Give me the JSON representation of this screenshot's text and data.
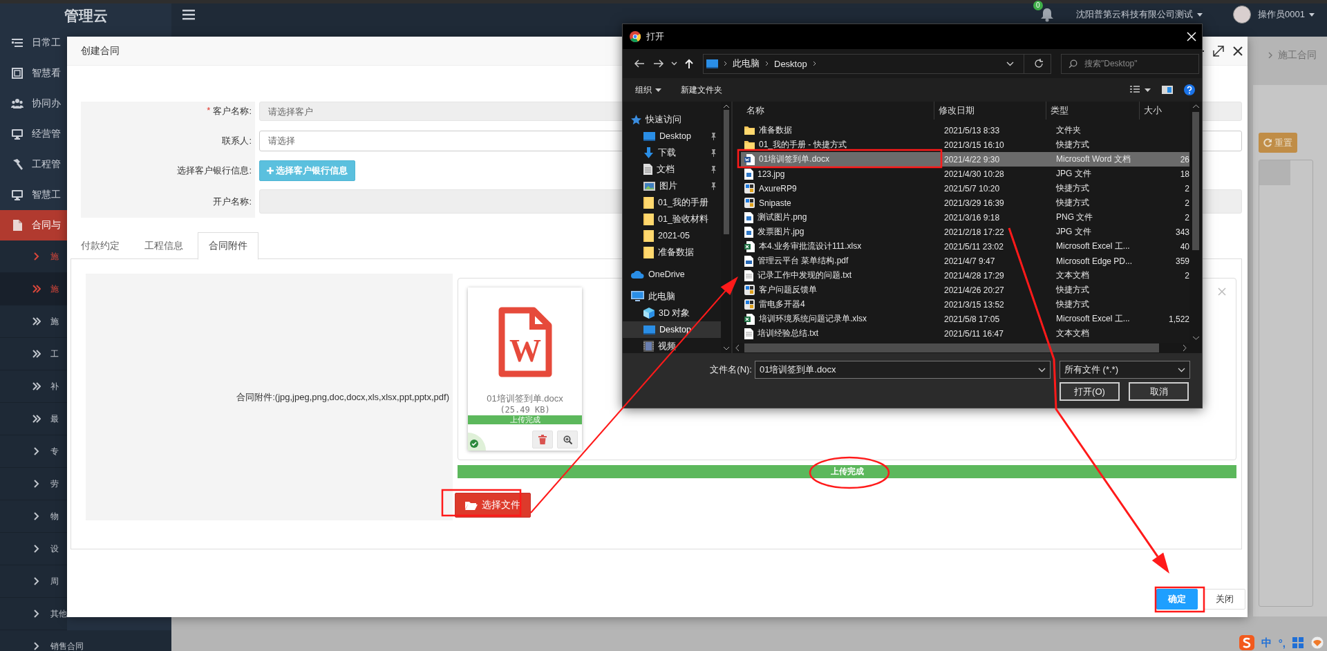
{
  "topbar": {
    "logo": "管理云",
    "notification_count": "0",
    "company": "沈阳普第云科技有限公司测试",
    "user": "操作员0001"
  },
  "sidebar": {
    "items": [
      {
        "label": "日常工",
        "selected": false
      },
      {
        "label": "智慧看",
        "selected": false
      },
      {
        "label": "协同办",
        "selected": false
      },
      {
        "label": "经营管",
        "selected": false
      },
      {
        "label": "工程管",
        "selected": false
      },
      {
        "label": "智慧工",
        "selected": false
      },
      {
        "label": "合同与",
        "selected": true,
        "children": [
          {
            "label": "施",
            "kind": "group",
            "selected": true
          },
          {
            "label": "施",
            "kind": "page",
            "selected": true
          },
          {
            "label": "施",
            "kind": "page",
            "selected": false
          },
          {
            "label": "工",
            "kind": "page",
            "selected": false
          },
          {
            "label": "补",
            "kind": "page",
            "selected": false
          },
          {
            "label": "最",
            "kind": "page",
            "selected": false
          },
          {
            "label": "专",
            "kind": "group",
            "selected": false
          },
          {
            "label": "劳",
            "kind": "group",
            "selected": false
          },
          {
            "label": "物",
            "kind": "group",
            "selected": false
          },
          {
            "label": "设",
            "kind": "group",
            "selected": false
          },
          {
            "label": "周",
            "kind": "group",
            "selected": false
          },
          {
            "label": "其他",
            "kind": "group",
            "selected": false
          },
          {
            "label": "销售合同",
            "kind": "group",
            "selected": false
          }
        ]
      }
    ]
  },
  "content": {
    "breadcrumb": "施工合同",
    "reset_button": "重置"
  },
  "modal": {
    "title": "创建合同",
    "form": {
      "fields": [
        {
          "label": "客户名称:",
          "kind": "input",
          "required_mark": "*",
          "disabled": true,
          "placeholder": "请选择客户"
        },
        {
          "label": "联系人:",
          "kind": "input",
          "disabled": false,
          "placeholder": "请选择"
        },
        {
          "label": "选择客户银行信息:",
          "kind": "button",
          "button": "选择客户银行信息"
        },
        {
          "label": "开户名称:",
          "kind": "input",
          "disabled": true
        }
      ]
    },
    "tabs": [
      {
        "label": "付款约定",
        "selected": false
      },
      {
        "label": "工程信息",
        "selected": false
      },
      {
        "label": "合同附件",
        "selected": true
      }
    ],
    "attachment": {
      "label": "合同附件:(jpg,jpeg,png,doc,docx,xls,xlsx,ppt,pptx,pdf)",
      "files": [
        {
          "name": "01培训签到单.docx",
          "size": "(25.49 KB)",
          "status": "上传完成",
          "level": 1,
          "kind": "word",
          "icon_letter": "W"
        }
      ],
      "progress": {
        "label": "上传完成",
        "level": 1
      },
      "choose_button": "选择文件"
    },
    "footer_buttons": [
      {
        "label": "确定",
        "kind": "primary"
      },
      {
        "label": "关闭",
        "kind": "default"
      }
    ]
  },
  "file_dialog": {
    "title": "打开",
    "path": [
      "此电脑",
      "Desktop"
    ],
    "search_placeholder": "搜索\"Desktop\"",
    "toolbar": [
      "组织",
      "新建文件夹"
    ],
    "nav": [
      {
        "label": "快速访问",
        "kind": "quick",
        "selected": false,
        "children": [
          {
            "label": "Desktop",
            "kind": "desktop",
            "selected": false
          },
          {
            "label": "下载",
            "kind": "download",
            "selected": false
          },
          {
            "label": "文档",
            "kind": "docs",
            "selected": false
          },
          {
            "label": "图片",
            "kind": "pictures",
            "selected": false
          },
          {
            "label": "01_我的手册",
            "kind": "folder",
            "selected": false
          },
          {
            "label": "01_验收材料",
            "kind": "folder",
            "selected": false
          },
          {
            "label": "2021-05",
            "kind": "folder",
            "selected": false
          },
          {
            "label": "准备数据",
            "kind": "folder",
            "selected": false
          }
        ]
      },
      {
        "label": "OneDrive",
        "kind": "cloud",
        "selected": false
      },
      {
        "label": "此电脑",
        "kind": "pc",
        "selected": false,
        "children": [
          {
            "label": "3D 对象",
            "kind": "cube",
            "selected": false
          },
          {
            "label": "Desktop",
            "kind": "desktop",
            "selected": true
          },
          {
            "label": "视频",
            "kind": "video",
            "selected": false
          }
        ]
      }
    ],
    "columns": [
      "名称",
      "修改日期",
      "类型",
      "大小"
    ],
    "files": [
      {
        "name": "准备数据",
        "modified": "2021/5/13 8:33",
        "type": "文件夹",
        "kind": "folder",
        "selected": false
      },
      {
        "name": "01_我的手册 - 快捷方式",
        "modified": "2021/3/15 16:10",
        "type": "快捷方式",
        "kind": "folder",
        "selected": false
      },
      {
        "name": "01培训签到单.docx",
        "modified": "2021/4/22 9:30",
        "type": "Microsoft Word 文档",
        "size": "26",
        "kind": "word",
        "selected": true
      },
      {
        "name": "123.jpg",
        "modified": "2021/4/30 10:28",
        "type": "JPG 文件",
        "size": "18",
        "kind": "image",
        "selected": false
      },
      {
        "name": "AxureRP9",
        "modified": "2021/5/7 10:20",
        "type": "快捷方式",
        "size": "2",
        "kind": "app",
        "selected": false
      },
      {
        "name": "Snipaste",
        "modified": "2021/3/29 16:39",
        "type": "快捷方式",
        "size": "2",
        "kind": "app",
        "selected": false
      },
      {
        "name": "测试图片.png",
        "modified": "2021/3/16 9:18",
        "type": "PNG 文件",
        "size": "2",
        "kind": "image",
        "selected": false
      },
      {
        "name": "发票图片.jpg",
        "modified": "2021/2/18 17:22",
        "type": "JPG 文件",
        "size": "343",
        "kind": "image",
        "selected": false
      },
      {
        "name": "本4.业务审批流设计111.xlsx",
        "modified": "2021/5/11 23:02",
        "type": "Microsoft Excel 工...",
        "size": "40",
        "kind": "excel",
        "selected": false
      },
      {
        "name": "管理云平台 菜单结构.pdf",
        "modified": "2021/4/7 9:47",
        "type": "Microsoft Edge PD...",
        "size": "359",
        "kind": "pdf",
        "selected": false
      },
      {
        "name": "记录工作中发现的问题.txt",
        "modified": "2021/4/28 17:29",
        "type": "文本文档",
        "size": "2",
        "kind": "text",
        "selected": false
      },
      {
        "name": "客户问题反馈单",
        "modified": "2021/4/26 20:27",
        "type": "快捷方式",
        "kind": "app",
        "selected": false
      },
      {
        "name": "雷电多开器4",
        "modified": "2021/3/15 13:52",
        "type": "快捷方式",
        "kind": "app",
        "selected": false
      },
      {
        "name": "培训环境系统问题记录单.xlsx",
        "modified": "2021/5/8 17:05",
        "type": "Microsoft Excel 工...",
        "size": "1,522",
        "kind": "excel",
        "selected": false
      },
      {
        "name": "培训经验总结.txt",
        "modified": "2021/5/11 16:47",
        "type": "文本文档",
        "kind": "text",
        "selected": false
      }
    ],
    "filename_label": "文件名(N):",
    "filename": "01培训签到单.docx",
    "filter": "所有文件 (*.*)",
    "buttons": [
      "打开(O)",
      "取消"
    ]
  },
  "ime": {
    "mode": "中",
    "punctuation": "°,"
  }
}
